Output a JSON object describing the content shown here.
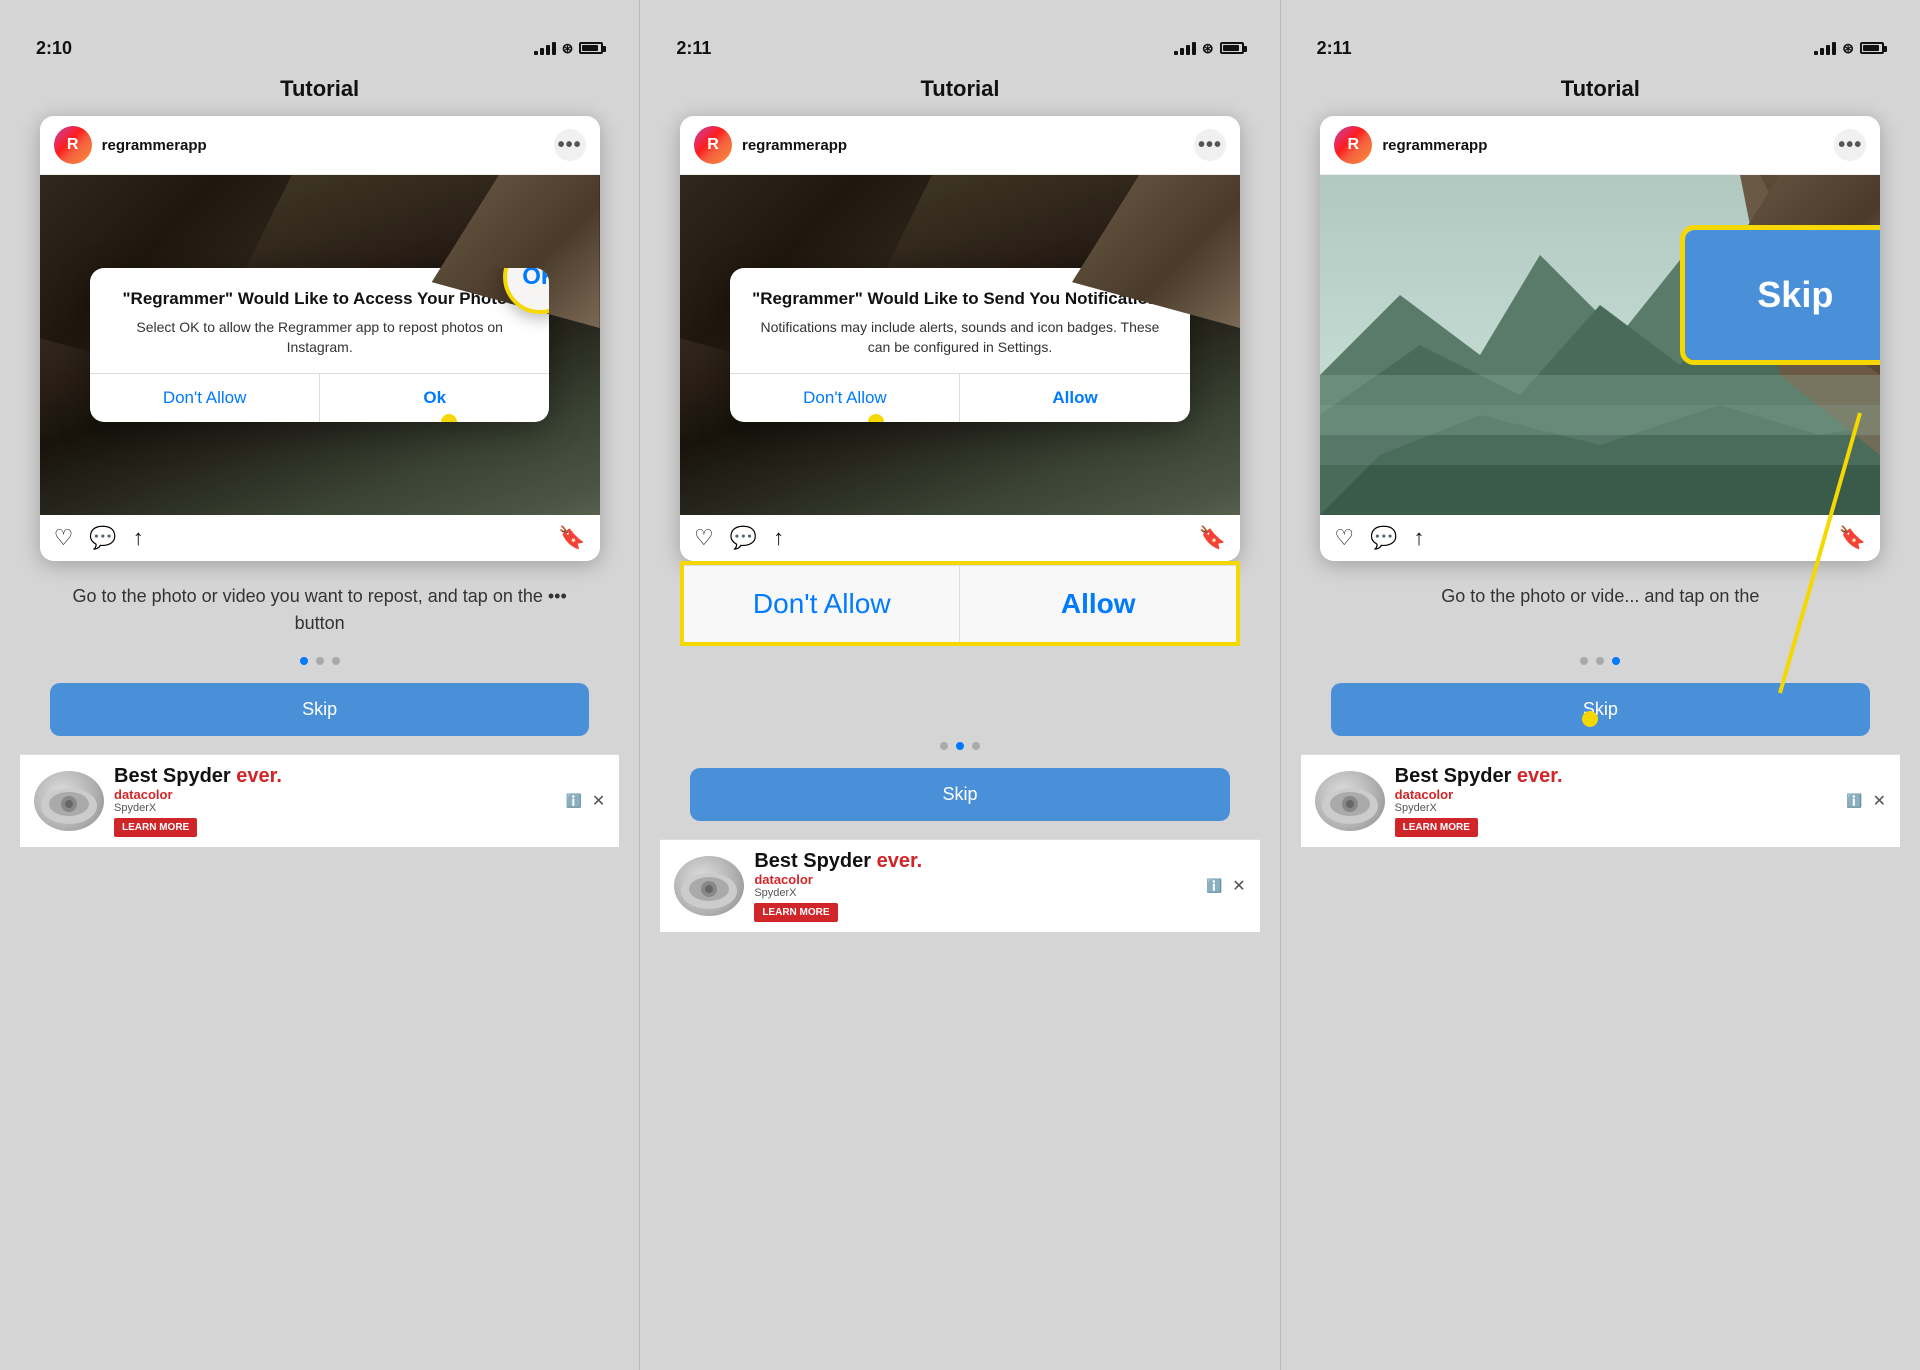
{
  "screens": [
    {
      "id": "screen1",
      "time": "2:10",
      "time_arrow": "◀",
      "title": "Tutorial",
      "username": "regrammerapp",
      "avatar_letter": "R",
      "dialog": {
        "title": "\"Regrammer\" Would Like to Access Your Photos",
        "message": "Select OK to allow the Regrammer app to repost photos on Instagram.",
        "btn_left": "Don't Allow",
        "btn_right": "Ok"
      },
      "annotation": {
        "label": "OK",
        "style": "ok"
      },
      "bottom_text": "Go to the photo or video you want to repost, and tap on the ••• button",
      "dots": [
        true,
        false,
        false
      ],
      "skip_label": "Skip",
      "ad": {
        "big": "Best Spyder ever.",
        "brand": "datacolor",
        "product": "SpyderX",
        "cta": "LEARN MORE"
      }
    },
    {
      "id": "screen2",
      "time": "2:11",
      "time_arrow": "◀",
      "title": "Tutorial",
      "username": "regrammerapp",
      "avatar_letter": "R",
      "dialog": {
        "title": "\"Regrammer\" Would Like to Send You Notifications",
        "message": "Notifications may include alerts, sounds and icon badges. These can be configured in Settings.",
        "btn_left": "Don't Allow",
        "btn_right": "Allow"
      },
      "highlight_buttons": true,
      "large_buttons": {
        "left": "Don't Allow",
        "right": "Allow"
      },
      "bottom_text": "",
      "dots": [
        false,
        true,
        false
      ],
      "skip_label": "Skip",
      "ad": {
        "big": "Best Spyder ever.",
        "brand": "datacolor",
        "product": "SpyderX",
        "cta": "LEARN MORE"
      }
    },
    {
      "id": "screen3",
      "time": "2:11",
      "time_arrow": "◀",
      "title": "Tutorial",
      "username": "regrammerapp",
      "avatar_letter": "R",
      "dialog": null,
      "bottom_text": "Go to the photo or vide... and tap on the",
      "dots": [
        false,
        false,
        true
      ],
      "skip_label": "Skip",
      "skip_big_label": "Skip",
      "ad": {
        "big": "Best Spyder ever.",
        "brand": "datacolor",
        "product": "SpyderX",
        "cta": "LEARN MORE"
      }
    }
  ],
  "colors": {
    "accent": "#007AFF",
    "highlight": "#F5D800",
    "skip_bg": "#4A90D9",
    "ad_red": "#d0262a"
  }
}
